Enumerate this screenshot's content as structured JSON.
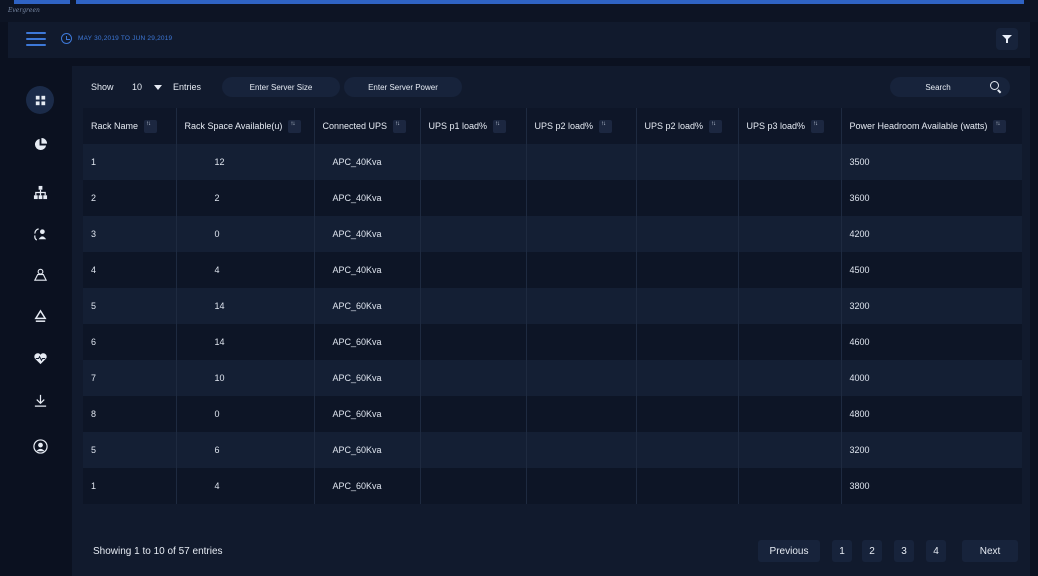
{
  "brand": "Evergreen",
  "header": {
    "date_range": "MAY 30,2019 TO JUN 29,2019"
  },
  "sidebar": {
    "items": [
      {
        "icon": "dashboard-icon",
        "active": true
      },
      {
        "icon": "pie-chart-icon",
        "active": false
      },
      {
        "icon": "hierarchy-icon",
        "active": false
      },
      {
        "icon": "users-sync-icon",
        "active": false
      },
      {
        "icon": "map-icon",
        "active": false
      },
      {
        "icon": "recycle-icon",
        "active": false
      },
      {
        "icon": "heart-rate-icon",
        "active": false
      },
      {
        "icon": "download-icon",
        "active": false
      },
      {
        "icon": "user-profile-icon",
        "active": false
      }
    ]
  },
  "controls": {
    "show_label": "Show",
    "show_value": "10",
    "entries_label": "Entries",
    "server_size_placeholder": "Enter Server Size",
    "server_power_placeholder": "Enter Server Power",
    "search_placeholder": "Search"
  },
  "table": {
    "columns": [
      "Rack Name",
      "Rack Space Available(u)",
      "Connected UPS",
      "UPS p1 load%",
      "UPS p2 load%",
      "UPS p2 load%",
      "UPS p3 load%",
      "Power Headroom Available (watts)"
    ],
    "rows": [
      [
        "1",
        "12",
        "APC_40Kva",
        "",
        "",
        "",
        "",
        "3500"
      ],
      [
        "2",
        "2",
        "APC_40Kva",
        "",
        "",
        "",
        "",
        "3600"
      ],
      [
        "3",
        "0",
        "APC_40Kva",
        "",
        "",
        "",
        "",
        "4200"
      ],
      [
        "4",
        "4",
        "APC_40Kva",
        "",
        "",
        "",
        "",
        "4500"
      ],
      [
        "5",
        "14",
        "APC_60Kva",
        "",
        "",
        "",
        "",
        "3200"
      ],
      [
        "6",
        "14",
        "APC_60Kva",
        "",
        "",
        "",
        "",
        "4600"
      ],
      [
        "7",
        "10",
        "APC_60Kva",
        "",
        "",
        "",
        "",
        "4000"
      ],
      [
        "8",
        "0",
        "APC_60Kva",
        "",
        "",
        "",
        "",
        "4800"
      ],
      [
        "5",
        "6",
        "APC_60Kva",
        "",
        "",
        "",
        "",
        "3200"
      ],
      [
        "1",
        "4",
        "APC_60Kva",
        "",
        "",
        "",
        "",
        "3800"
      ]
    ]
  },
  "footer": {
    "showing": "Showing 1 to 10 of 57 entries",
    "previous": "Previous",
    "pages": [
      "1",
      "2",
      "3",
      "4"
    ],
    "next": "Next"
  },
  "colors": {
    "accent": "#3d78d8",
    "panel": "#111a2d",
    "background": "#0b1120"
  }
}
